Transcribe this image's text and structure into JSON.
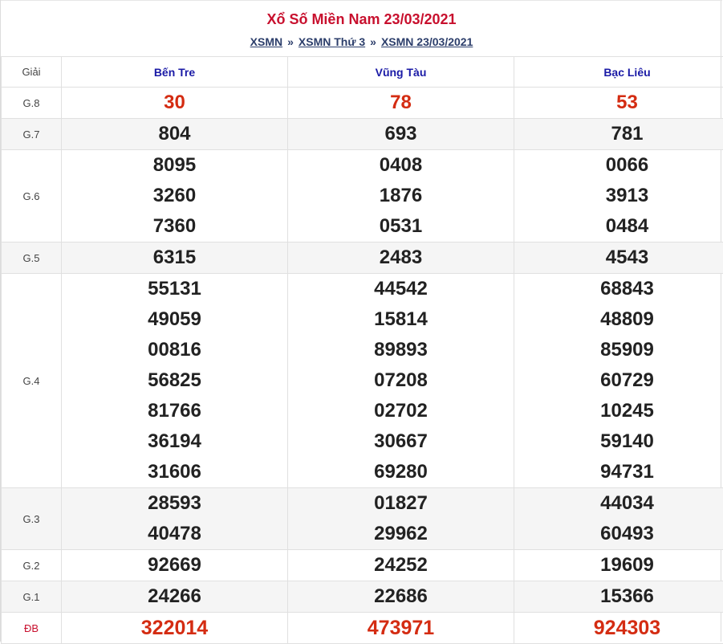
{
  "header": {
    "title": "Xổ Số Miền Nam 23/03/2021",
    "crumbs": [
      "XSMN",
      "XSMN Thứ 3",
      "XSMN 23/03/2021"
    ],
    "separator": "»"
  },
  "table": {
    "label_header": "Giải",
    "provinces": [
      "Bến Tre",
      "Vũng Tàu",
      "Bạc Liêu"
    ],
    "rows": [
      {
        "label": "G.8",
        "values": [
          [
            "30"
          ],
          [
            "78"
          ],
          [
            "53"
          ]
        ]
      },
      {
        "label": "G.7",
        "values": [
          [
            "804"
          ],
          [
            "693"
          ],
          [
            "781"
          ]
        ]
      },
      {
        "label": "G.6",
        "values": [
          [
            "8095",
            "3260",
            "7360"
          ],
          [
            "0408",
            "1876",
            "0531"
          ],
          [
            "0066",
            "3913",
            "0484"
          ]
        ]
      },
      {
        "label": "G.5",
        "values": [
          [
            "6315"
          ],
          [
            "2483"
          ],
          [
            "4543"
          ]
        ]
      },
      {
        "label": "G.4",
        "values": [
          [
            "55131",
            "49059",
            "00816",
            "56825",
            "81766",
            "36194",
            "31606"
          ],
          [
            "44542",
            "15814",
            "89893",
            "07208",
            "02702",
            "30667",
            "69280"
          ],
          [
            "68843",
            "48809",
            "85909",
            "60729",
            "10245",
            "59140",
            "94731"
          ]
        ]
      },
      {
        "label": "G.3",
        "values": [
          [
            "28593",
            "40478"
          ],
          [
            "01827",
            "29962"
          ],
          [
            "44034",
            "60493"
          ]
        ]
      },
      {
        "label": "G.2",
        "values": [
          [
            "92669"
          ],
          [
            "24252"
          ],
          [
            "19609"
          ]
        ]
      },
      {
        "label": "G.1",
        "values": [
          [
            "24266"
          ],
          [
            "22686"
          ],
          [
            "15366"
          ]
        ]
      },
      {
        "label": "ĐB",
        "values": [
          [
            "322014"
          ],
          [
            "473971"
          ],
          [
            "924303"
          ]
        ]
      }
    ]
  },
  "colors": {
    "title": "#c8102e",
    "province": "#1a1aa6",
    "highlight_number": "#d42c12",
    "alt_row": "#f5f5f5"
  }
}
